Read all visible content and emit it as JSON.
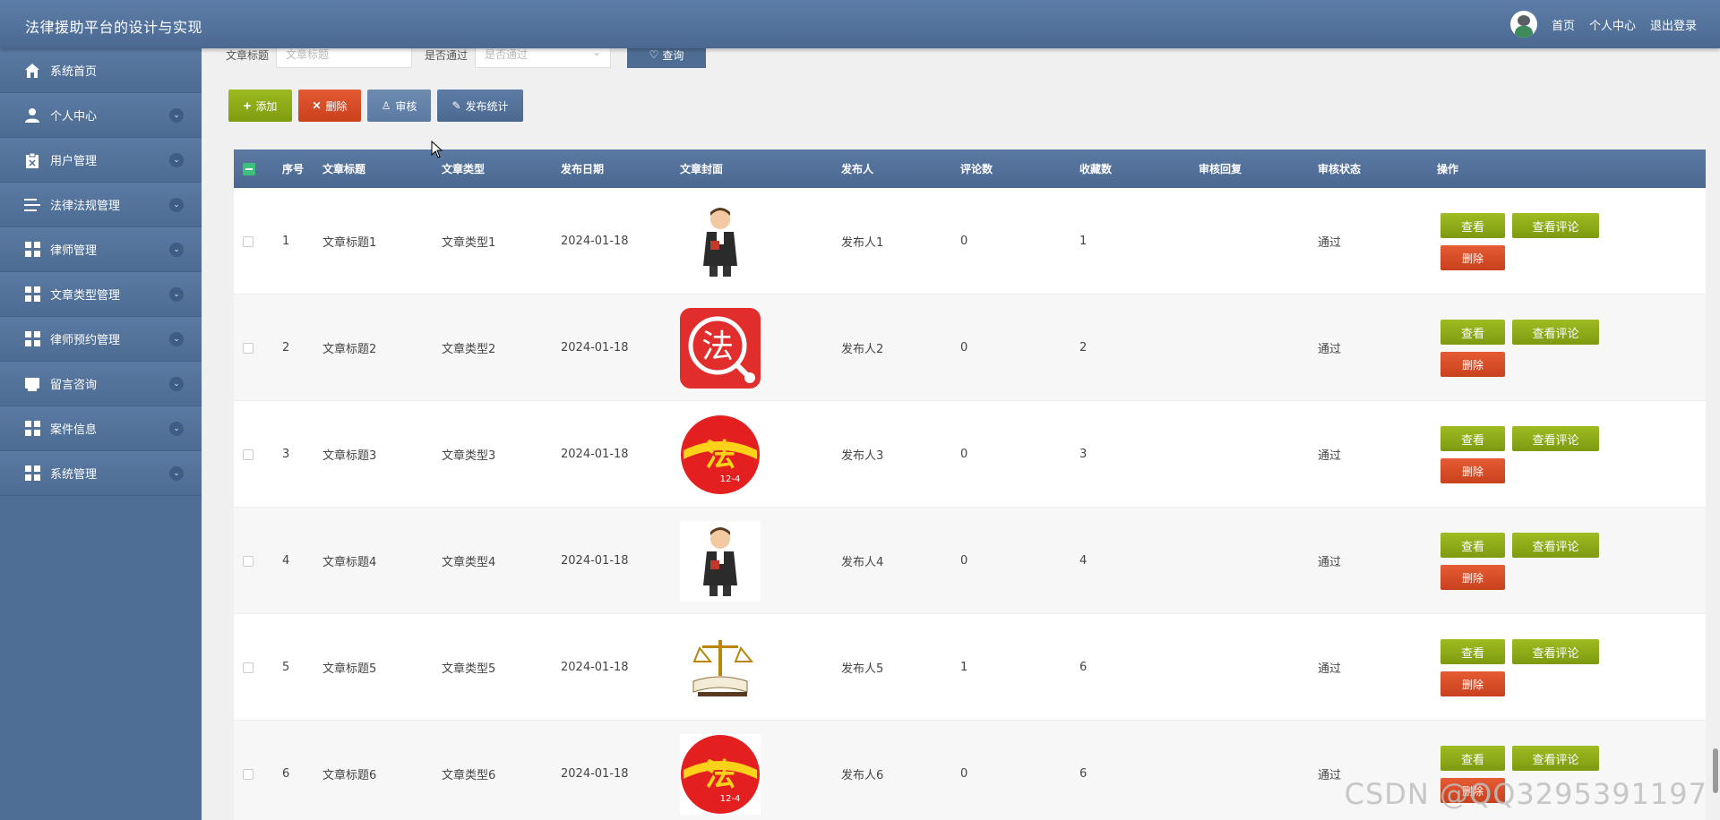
{
  "app": {
    "title": "法律援助平台的设计与实现"
  },
  "header": {
    "links": [
      "首页",
      "个人中心",
      "退出登录"
    ]
  },
  "sidebar": {
    "items": [
      {
        "label": "系统首页",
        "icon": "home-icon"
      },
      {
        "label": "个人中心",
        "icon": "person-icon"
      },
      {
        "label": "用户管理",
        "icon": "clipboard-icon"
      },
      {
        "label": "法律法规管理",
        "icon": "list-icon"
      },
      {
        "label": "律师管理",
        "icon": "grid-icon"
      },
      {
        "label": "文章类型管理",
        "icon": "grid-icon"
      },
      {
        "label": "律师预约管理",
        "icon": "grid-icon"
      },
      {
        "label": "留言咨询",
        "icon": "inbox-icon"
      },
      {
        "label": "案件信息",
        "icon": "grid-icon"
      },
      {
        "label": "系统管理",
        "icon": "grid-icon"
      }
    ]
  },
  "search": {
    "title_label": "文章标题",
    "title_placeholder": "文章标题",
    "passed_label": "是否通过",
    "passed_placeholder": "是否通过",
    "query_label": "查询"
  },
  "actions": {
    "add": "添加",
    "delete": "删除",
    "audit": "审核",
    "stats": "发布统计"
  },
  "table": {
    "headers": [
      "序号",
      "文章标题",
      "文章类型",
      "发布日期",
      "文章封面",
      "发布人",
      "评论数",
      "收藏数",
      "审核回复",
      "审核状态",
      "操作"
    ],
    "op_labels": {
      "view": "查看",
      "comments": "查看评论",
      "delete": "删除"
    },
    "rows": [
      {
        "no": "1",
        "title": "文章标题1",
        "type": "文章类型1",
        "date": "2024-01-18",
        "cover": "lawyer",
        "author": "发布人1",
        "comments": "0",
        "favorites": "1",
        "reply": "",
        "status": "通过"
      },
      {
        "no": "2",
        "title": "文章标题2",
        "type": "文章类型2",
        "date": "2024-01-18",
        "cover": "fa-red",
        "author": "发布人2",
        "comments": "0",
        "favorites": "2",
        "reply": "",
        "status": "通过"
      },
      {
        "no": "3",
        "title": "文章标题3",
        "type": "文章类型3",
        "date": "2024-01-18",
        "cover": "fa-circle",
        "author": "发布人3",
        "comments": "0",
        "favorites": "3",
        "reply": "",
        "status": "通过"
      },
      {
        "no": "4",
        "title": "文章标题4",
        "type": "文章类型4",
        "date": "2024-01-18",
        "cover": "lawyer",
        "author": "发布人4",
        "comments": "0",
        "favorites": "4",
        "reply": "",
        "status": "通过"
      },
      {
        "no": "5",
        "title": "文章标题5",
        "type": "文章类型5",
        "date": "2024-01-18",
        "cover": "scales",
        "author": "发布人5",
        "comments": "1",
        "favorites": "6",
        "reply": "",
        "status": "通过"
      },
      {
        "no": "6",
        "title": "文章标题6",
        "type": "文章类型6",
        "date": "2024-01-18",
        "cover": "fa-circle",
        "author": "发布人6",
        "comments": "0",
        "favorites": "6",
        "reply": "",
        "status": "通过"
      }
    ]
  },
  "cover_glyphs": {
    "fa": "法",
    "badge": "12-4"
  },
  "watermark": "CSDN @QQ3295391197",
  "colors": {
    "topbar": "#4f6d95",
    "sidebar": "#4e6e96",
    "green": "#8aaa17",
    "red": "#d34a24"
  }
}
